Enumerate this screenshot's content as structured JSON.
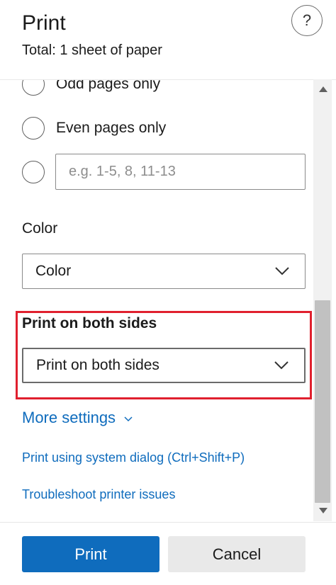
{
  "header": {
    "title": "Print",
    "subtitle": "Total: 1 sheet of paper",
    "help_label": "?"
  },
  "pages": {
    "options": [
      {
        "label": "Odd pages only",
        "selected": false
      },
      {
        "label": "Even pages only",
        "selected": false
      },
      {
        "label": "",
        "selected": false
      }
    ],
    "custom_range_placeholder": "e.g. 1-5, 8, 11-13",
    "custom_range_value": ""
  },
  "color": {
    "label": "Color",
    "value": "Color"
  },
  "duplex": {
    "label": "Print on both sides",
    "value": "Print on both sides"
  },
  "links": {
    "more_settings": "More settings",
    "system_dialog": "Print using system dialog (Ctrl+Shift+P)",
    "troubleshoot": "Troubleshoot printer issues"
  },
  "footer": {
    "print_label": "Print",
    "cancel_label": "Cancel"
  },
  "colors": {
    "accent": "#0f6cbd",
    "highlight": "#e0202e"
  }
}
